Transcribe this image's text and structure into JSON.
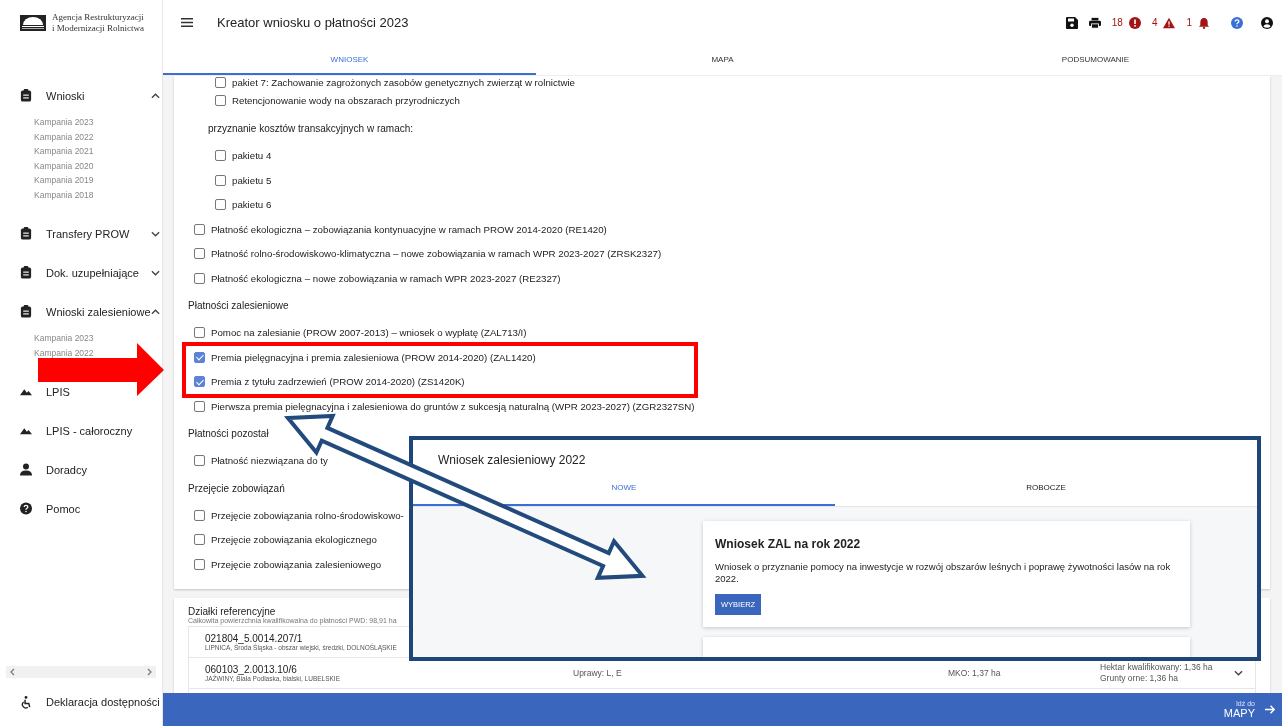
{
  "sidebar": {
    "logo_lines": [
      "Agencja Restrukturyzacji",
      "i Modernizacji Rolnictwa"
    ],
    "items": [
      {
        "label": "Wnioski",
        "kind": "folder",
        "expanded": true,
        "children": [
          "Kampania 2023",
          "Kampania 2022",
          "Kampania 2021",
          "Kampania 2020",
          "Kampania 2019",
          "Kampania 2018"
        ]
      },
      {
        "label": "Transfery PROW",
        "kind": "folder",
        "expanded": false
      },
      {
        "label": "Dok. uzupełniające",
        "kind": "folder",
        "expanded": false
      },
      {
        "label": "Wnioski zalesieniowe",
        "kind": "folder",
        "expanded": true,
        "children": [
          "Kampania 2023",
          "Kampania 2022"
        ]
      },
      {
        "label": "LPIS",
        "kind": "map"
      },
      {
        "label": "LPIS - całoroczny",
        "kind": "map"
      },
      {
        "label": "Doradcy",
        "kind": "advisors"
      },
      {
        "label": "Pomoc",
        "kind": "help"
      }
    ],
    "footer": {
      "label": "Deklaracja dostępności"
    }
  },
  "header": {
    "title": "Kreator wniosku o płatności 2023",
    "counters": [
      {
        "kind": "error",
        "count": "18"
      },
      {
        "kind": "warning",
        "count": "4"
      },
      {
        "kind": "notification",
        "count": "1"
      }
    ]
  },
  "tabs": [
    {
      "label": "WNIOSEK",
      "selected": true
    },
    {
      "label": "MAPA",
      "selected": false
    },
    {
      "label": "PODSUMOWANIE",
      "selected": false
    }
  ],
  "sections": [
    {
      "items": [
        {
          "kind": "group",
          "children": [
            {
              "kind": "checkbox",
              "label": "pakiet 7: Zachowanie zagrożonych zasobów genetycznych zwierząt w rolnictwie",
              "checked": false
            },
            {
              "kind": "checkbox",
              "label": "Retencjonowanie wody na obszarach przyrodniczych",
              "checked": false
            }
          ]
        },
        {
          "kind": "label",
          "label": "przyznanie kosztów transakcyjnych w ramach:",
          "children": [
            {
              "kind": "checkbox",
              "label": "pakietu 4",
              "checked": false
            },
            {
              "kind": "checkbox",
              "label": "pakietu 5",
              "checked": false
            },
            {
              "kind": "checkbox",
              "label": "pakietu 6",
              "checked": false
            }
          ]
        },
        {
          "kind": "checkbox",
          "label": "Płatność ekologiczna – zobowiązania kontynuacyjne w ramach PROW 2014-2020 (RE1420)",
          "checked": false
        },
        {
          "kind": "checkbox",
          "label": "Płatność rolno-środowiskowo-klimatyczna – nowe zobowiązania w ramach WPR 2023-2027 (ZRSK2327)",
          "checked": false
        },
        {
          "kind": "checkbox",
          "label": "Płatność ekologiczna – nowe zobowiązania w ramach WPR 2023-2027 (RE2327)",
          "checked": false
        }
      ]
    },
    {
      "title": "Płatności zalesieniowe",
      "items": [
        {
          "kind": "checkbox",
          "label": "Pomoc na zalesianie (PROW 2007-2013) – wniosek o wypłatę (ZAL713/I)",
          "checked": false
        },
        {
          "kind": "checkbox",
          "label": "Premia pielęgnacyjna i premia zalesieniowa (PROW 2014-2020) (ZAL1420)",
          "checked": true
        },
        {
          "kind": "checkbox",
          "label": "Premia z tytułu zadrzewień (PROW 2014-2020) (ZS1420K)",
          "checked": true
        },
        {
          "kind": "checkbox",
          "label": "Pierwsza premia pielęgnacyjna i zalesieniowa do gruntów z sukcesją naturalną (WPR 2023-2027) (ZGR2327SN)",
          "checked": false
        }
      ]
    },
    {
      "title": "Płatności pozostał",
      "items": [
        {
          "kind": "checkbox",
          "label": "Płatność niezwiązana do ty",
          "checked": false
        }
      ]
    },
    {
      "title": "Przejęcie zobowiązań",
      "items": [
        {
          "kind": "checkbox",
          "label": "Przejęcie zobowiązania rolno-środowiskowo-",
          "checked": false
        },
        {
          "kind": "checkbox",
          "label": "Przejęcie zobowiązania ekologicznego",
          "checked": false
        },
        {
          "kind": "checkbox",
          "label": "Przejęcie zobowiązania zalesieniowego",
          "checked": false
        }
      ]
    }
  ],
  "parcels": {
    "title": "Działki referencyjne",
    "subtitle": "Całkowita powierzchnia kwalifikowalna do płatności PWD: 98,91 ha",
    "rows": [
      {
        "id": "021804_5.0014.207/1",
        "location": "LIPNICA, Środa Śląska - obszar wiejski, średzki, DOLNOŚLĄSKIE"
      },
      {
        "id": "060103_2.0013.10/6",
        "location": "JAŹWINY, Biała Podlaska, bialski, LUBELSKIE",
        "crops": "Uprawy: L, E",
        "mko": "MKO: 1,37 ha",
        "eligible": "Hektar kwalifikowany: 1,36 ha",
        "arable": "Grunty orne: 1,36 ha"
      }
    ]
  },
  "footer_bar": {
    "hint": "Idź do",
    "action": "MAPY"
  },
  "inset": {
    "title": "Wniosek zalesieniowy 2022",
    "tabs": [
      {
        "label": "NOWE",
        "selected": true
      },
      {
        "label": "ROBOCZE",
        "selected": false
      }
    ],
    "card": {
      "title": "Wniosek ZAL na rok 2022",
      "text": "Wniosek o przyznanie pomocy na inwestycje w rozwój obszarów leśnych i poprawę żywotności lasów na rok 2022.",
      "button": "WYBIERZ"
    }
  }
}
